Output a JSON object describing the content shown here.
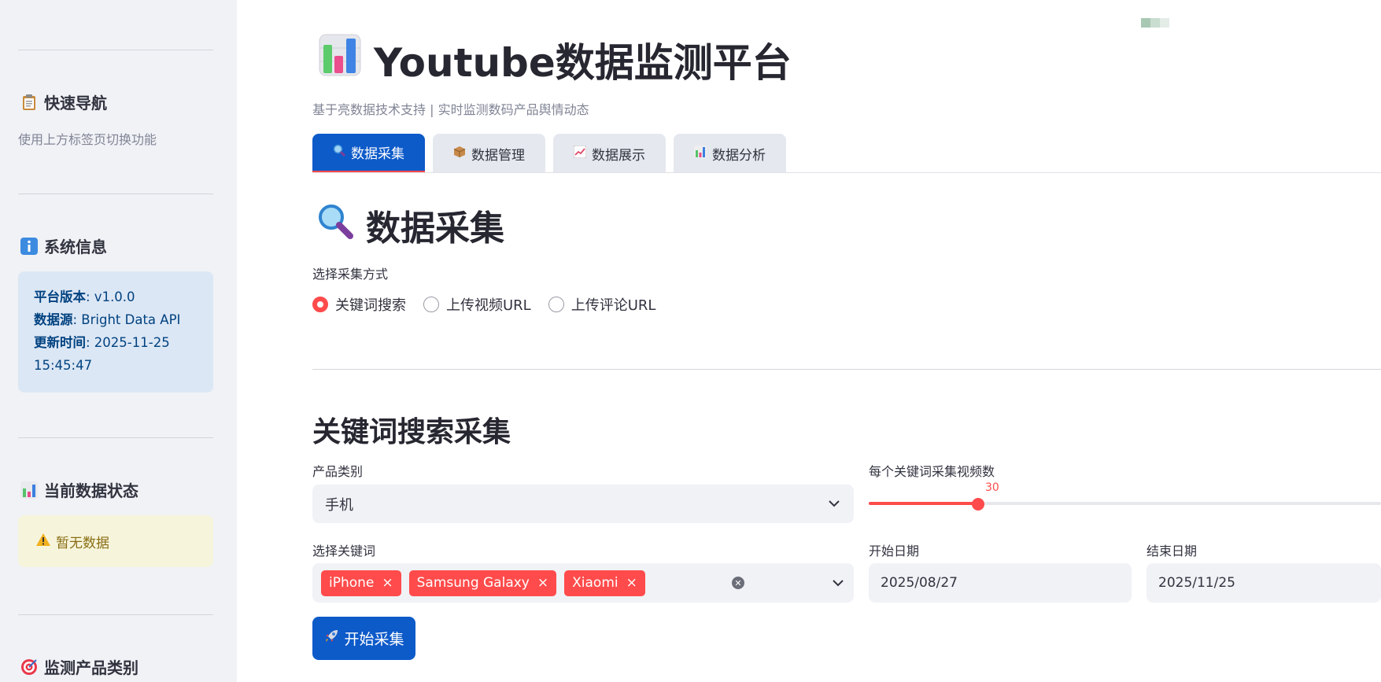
{
  "sidebar": {
    "nav": {
      "title": "快速导航",
      "icon": "clipboard-icon",
      "hint": "使用上方标签页切换功能"
    },
    "system": {
      "title": "系统信息",
      "icon": "info-icon",
      "version_label": "平台版本",
      "version_value": ": v1.0.0",
      "source_label": "数据源",
      "source_value": ": Bright Data API",
      "updated_label": "更新时间",
      "updated_value": ": 2025-11-25",
      "updated_time": "15:45:47"
    },
    "status": {
      "title": "当前数据状态",
      "icon": "bar-chart-icon",
      "warning": "暂无数据",
      "warning_icon": "warning-icon"
    },
    "categories": {
      "title": "监测产品类别",
      "icon": "target-icon"
    }
  },
  "header": {
    "title": "Youtube数据监测平台",
    "title_icon": "bar-chart-icon",
    "subtitle": "基于亮数据技术支持 | 实时监测数码产品舆情动态"
  },
  "tabs": [
    {
      "label": "数据采集",
      "icon": "magnifier-icon",
      "active": true
    },
    {
      "label": "数据管理",
      "icon": "package-icon",
      "active": false
    },
    {
      "label": "数据展示",
      "icon": "line-chart-icon",
      "active": false
    },
    {
      "label": "数据分析",
      "icon": "bar-chart-icon",
      "active": false
    }
  ],
  "collect": {
    "title": "数据采集",
    "title_icon": "magnifier-icon",
    "method_label": "选择采集方式",
    "methods": [
      "关键词搜索",
      "上传视频URL",
      "上传评论URL"
    ],
    "selected_method": "关键词搜索"
  },
  "keyword_search": {
    "title": "关键词搜索采集",
    "category_label": "产品类别",
    "category_value": "手机",
    "count_label": "每个关键词采集视频数",
    "count_value": "30",
    "count_fraction": 0.213,
    "keywords_label": "选择关键词",
    "keywords": [
      "iPhone",
      "Samsung Galaxy",
      "Xiaomi"
    ],
    "start_label": "开始日期",
    "start_value": "2025/08/27",
    "end_label": "结束日期",
    "end_value": "2025/11/25",
    "button_label": "开始采集",
    "button_icon": "rocket-icon"
  },
  "colors": {
    "accent": "#ff4b4b",
    "primary": "#0d5ac9",
    "sidebar_bg": "#f0f2f6"
  }
}
